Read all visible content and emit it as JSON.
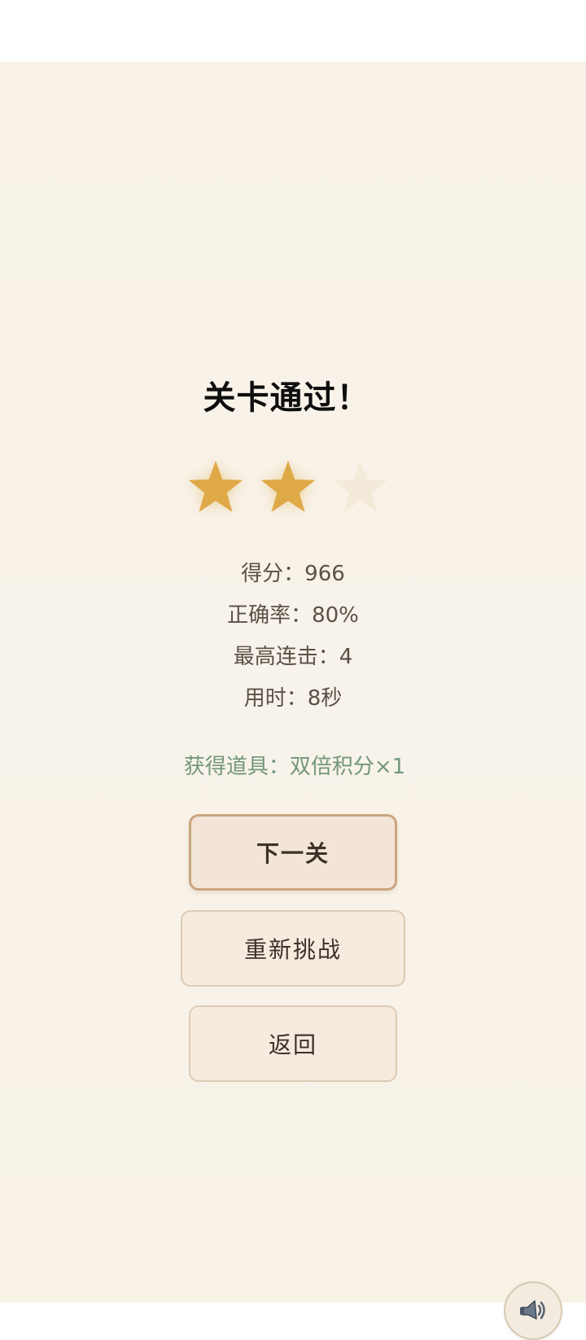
{
  "result": {
    "title": "关卡通过！",
    "stars_earned": 2,
    "stars_total": 3
  },
  "stats": [
    {
      "text": "得分：966"
    },
    {
      "text": "正确率：80%"
    },
    {
      "text": "最高连击：4"
    },
    {
      "text": "用时：8秒"
    }
  ],
  "reward": {
    "text": "获得道具：双倍积分×1"
  },
  "buttons": {
    "next_label": "下一关",
    "retry_label": "重新挑战",
    "back_label": "返回"
  },
  "sound": {
    "icon": "speaker-icon"
  },
  "colors": {
    "star_filled": "#e0a947",
    "star_empty": "#f4ead9",
    "reward_text": "#73967a",
    "background": "#f7f1e6"
  }
}
